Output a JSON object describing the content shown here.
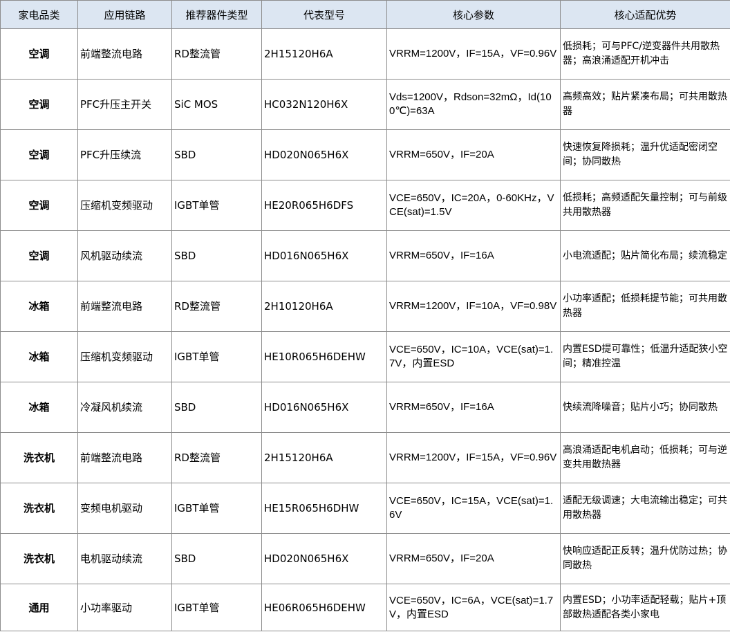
{
  "headers": [
    "家电品类",
    "应用链路",
    "推荐器件类型",
    "代表型号",
    "核心参数",
    "核心适配优势"
  ],
  "rows": [
    {
      "category": "空调",
      "application": "前端整流电路",
      "device_type": "RD整流管",
      "model": "2H15120H6A",
      "params": "VRRM=1200V，IF=15A，VF=0.96V",
      "advantage": "低损耗；可与PFC/逆变器件共用散热器；高浪涌适配开机冲击"
    },
    {
      "category": "空调",
      "application": "PFC升压主开关",
      "device_type": "SiC MOS",
      "model": "HC032N120H6X",
      "params": "Vds=1200V，Rdson=32mΩ，Id(100℃)=63A",
      "advantage": "高频高效；贴片紧凑布局；可共用散热器"
    },
    {
      "category": "空调",
      "application": "PFC升压续流",
      "device_type": "SBD",
      "model": "HD020N065H6X",
      "params": "VRRM=650V，IF=20A",
      "advantage": "快速恢复降损耗；温升优适配密闭空间；协同散热"
    },
    {
      "category": "空调",
      "application": "压缩机变频驱动",
      "device_type": "IGBT单管",
      "model": "HE20R065H6DFS",
      "params": "VCE=650V，IC=20A，0-60KHz，VCE(sat)=1.5V",
      "advantage": "低损耗；高频适配矢量控制；可与前级共用散热器"
    },
    {
      "category": "空调",
      "application": "风机驱动续流",
      "device_type": "SBD",
      "model": "HD016N065H6X",
      "params": "VRRM=650V，IF=16A",
      "advantage": "小电流适配；贴片简化布局；续流稳定"
    },
    {
      "category": "冰箱",
      "application": "前端整流电路",
      "device_type": "RD整流管",
      "model": "2H10120H6A",
      "params": "VRRM=1200V，IF=10A，VF=0.98V",
      "advantage": "小功率适配；低损耗提节能；可共用散热器"
    },
    {
      "category": "冰箱",
      "application": "压缩机变频驱动",
      "device_type": "IGBT单管",
      "model": "HE10R065H6DEHW",
      "params": "VCE=650V，IC=10A，VCE(sat)=1.7V，内置ESD",
      "advantage": "内置ESD提可靠性；低温升适配狭小空间；精准控温"
    },
    {
      "category": "冰箱",
      "application": "冷凝风机续流",
      "device_type": "SBD",
      "model": "HD016N065H6X",
      "params": "VRRM=650V，IF=16A",
      "advantage": "快续流降噪音；贴片小巧；协同散热"
    },
    {
      "category": "洗衣机",
      "application": "前端整流电路",
      "device_type": "RD整流管",
      "model": "2H15120H6A",
      "params": "VRRM=1200V，IF=15A，VF=0.96V",
      "advantage": "高浪涌适配电机启动；低损耗；可与逆变共用散热器"
    },
    {
      "category": "洗衣机",
      "application": "变频电机驱动",
      "device_type": "IGBT单管",
      "model": "HE15R065H6DHW",
      "params": "VCE=650V，IC=15A，VCE(sat)=1.6V",
      "advantage": "适配无级调速；大电流输出稳定；可共用散热器"
    },
    {
      "category": "洗衣机",
      "application": "电机驱动续流",
      "device_type": "SBD",
      "model": "HD020N065H6X",
      "params": "VRRM=650V，IF=20A",
      "advantage": "快响应适配正反转；温升优防过热；协同散热"
    },
    {
      "category": "通用",
      "application": "小功率驱动",
      "device_type": "IGBT单管",
      "model": "HE06R065H6DEHW",
      "params": "VCE=650V，IC=6A，VCE(sat)=1.7V，内置ESD",
      "advantage": "内置ESD；小功率适配轻载；贴片+顶部散热适配各类小家电"
    }
  ]
}
